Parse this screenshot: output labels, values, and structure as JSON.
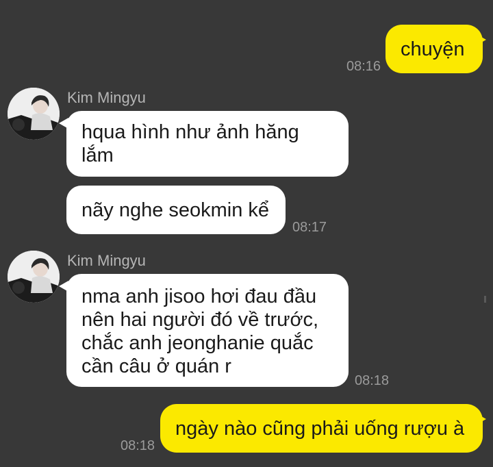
{
  "chat": {
    "messages": [
      {
        "type": "outgoing",
        "text": "chuyện",
        "time": "08:16"
      },
      {
        "type": "incoming",
        "sender": "Kim Mingyu",
        "text": "hqua hình như ảnh hăng\nlắm"
      },
      {
        "type": "incoming",
        "text": "nãy nghe seokmin kể",
        "time": "08:17"
      },
      {
        "type": "incoming",
        "sender": "Kim Mingyu",
        "text": "nma anh jisoo hơi đau đầu\nnên hai người đó về trước,\nchắc anh jeonghanie quắc\ncần câu ở quán r",
        "time": "08:18"
      },
      {
        "type": "outgoing",
        "text": "ngày nào cũng phải uống rượu à",
        "time": "08:18"
      }
    ]
  },
  "colors": {
    "background": "#383838",
    "outgoing_bubble": "#fbe900",
    "incoming_bubble": "#ffffff",
    "timestamp": "#9b9b9b",
    "sender_name": "#b5b5b5"
  }
}
